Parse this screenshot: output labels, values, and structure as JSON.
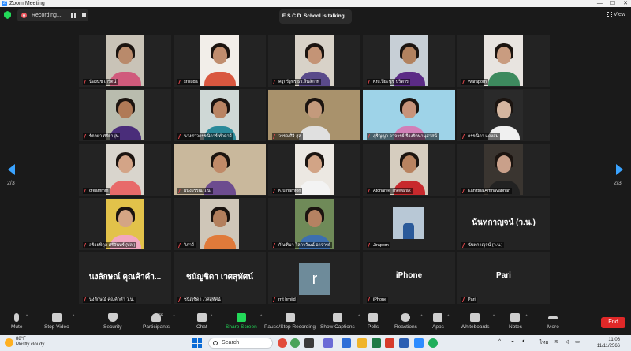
{
  "window": {
    "title": "Zoom Meeting"
  },
  "meeting": {
    "recording_label": "Recording...",
    "talking_label": "E.S.C.D. School is talking...",
    "view_label": "View",
    "page_indicator": "2/3"
  },
  "participants": [
    "น้องนุช เกรัตน์",
    "srisuda",
    "ครูกรัฐพร ธร.สิ้นลักาพ",
    "Kru.ปิยะนุช บริพาร",
    "Waraporn",
    "รัตลยา ศรียายุ่น",
    "นางสาวกรรณิการ์ ทำดาวี",
    "วรรณศิริ สุส",
    "ภูริญญา อาจารย์เรืองรัตนานุสาสน์",
    "กรรณิกา แดงสม",
    "creammm",
    "ผนงวรรณ ว.น.",
    "Kru namfon",
    "Atcharee Thewarak",
    "Kanittha Artthayaphan",
    "สร้อยพิกุล ศรีจันทร์ (ปล.)",
    "วิภาวี",
    "กัณฑิมา โลกาวัฒน์ อาจารย์",
    "Jiraporn",
    "นันทกาญจน์ (ว.น.)",
    "นงลักษณ์ คุณค้าคำ ว.น.",
    "ชนัญชิดา เวศสุทัศน์",
    "rrtt hrhjjd",
    "iPhone",
    "Pari"
  ],
  "name_cards": {
    "tile_20_big": "นันทกาญจน์ (ว.น.)",
    "tile_21_big": "นงลักษณ์ คุณค้าคำ...",
    "tile_22_big": "ชนัญชิดา เวศสุทัศน์",
    "tile_23_initial": "r",
    "tile_24_big": "iPhone",
    "tile_25_big": "Pari"
  },
  "toolbar": {
    "mute": "Mute",
    "stop_video": "Stop Video",
    "security": "Security",
    "participants": "Participants",
    "participants_count": "56",
    "chat": "Chat",
    "share_screen": "Share Screen",
    "pause_stop_recording": "Pause/Stop Recording",
    "show_captions": "Show Captions",
    "polls": "Polls",
    "reactions": "Reactions",
    "apps": "Apps",
    "whiteboards": "Whiteboards",
    "notes": "Notes",
    "more": "More",
    "end": "End"
  },
  "taskbar": {
    "temperature": "88°F",
    "weather": "Mostly cloudy",
    "search_placeholder": "Search",
    "language": "ไทย",
    "time": "11:06",
    "date": "11/11/2566"
  },
  "colors": {
    "accent": "#2d8cff",
    "share_green": "#23d959",
    "end_red": "#e02828",
    "muted_red": "#e5484d"
  }
}
